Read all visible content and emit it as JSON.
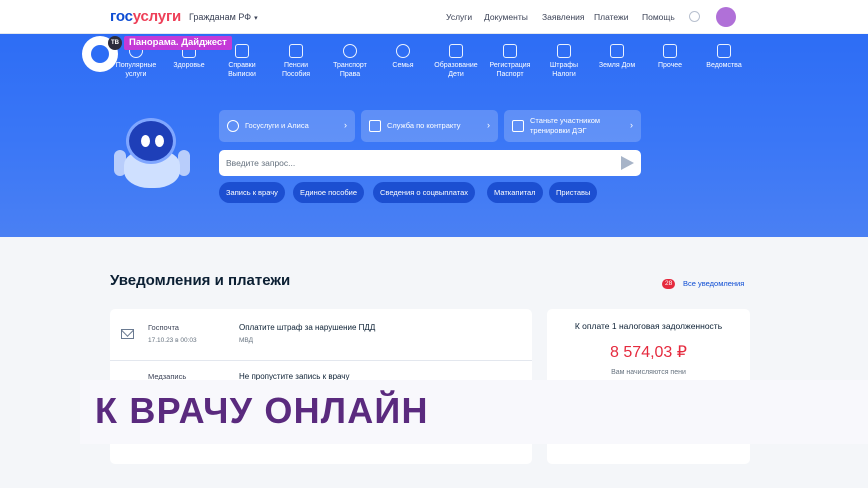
{
  "header": {
    "logo_part1": "гос",
    "logo_part2": "услуги",
    "audience_selector": "Гражданам РФ",
    "nav": [
      "Услуги",
      "Документы",
      "Заявления",
      "Платежи",
      "Помощь"
    ]
  },
  "tv_overlay": {
    "badge": "ТВ",
    "channel_label": "Панорама. Дайджест"
  },
  "categories": [
    [
      "Популярные",
      "услуги"
    ],
    [
      "Здоровье",
      ""
    ],
    [
      "Справки",
      "Выписки"
    ],
    [
      "Пенсии",
      "Пособия"
    ],
    [
      "Транспорт",
      "Права"
    ],
    [
      "Семья",
      ""
    ],
    [
      "Образование",
      "Дети"
    ],
    [
      "Регистрация",
      "Паспорт"
    ],
    [
      "Штрафы",
      "Налоги"
    ],
    [
      "Земля Дом",
      ""
    ],
    [
      "Прочее",
      ""
    ],
    [
      "Ведомства",
      ""
    ]
  ],
  "service_cards": [
    {
      "label": "Госуслуги и Алиса"
    },
    {
      "label": "Служба по контракту"
    },
    {
      "label": "Станьте участником тренировки ДЭГ"
    }
  ],
  "search": {
    "placeholder": "Введите запрос..."
  },
  "quick_chips": [
    "Запись к врачу",
    "Единое пособие",
    "Сведения о соцвыплатах",
    "Маткапитал",
    "Приставы"
  ],
  "notifications": {
    "title": "Уведомления и платежи",
    "count": "28",
    "all_link": "Все уведомления",
    "items": [
      {
        "source": "Госпочта",
        "date": "17.10.23 в 00:03",
        "title": "Оплатите штраф за нарушение ПДД",
        "org": "МВД"
      },
      {
        "source": "Медзапись",
        "title": "Не пропустите запись к врачу"
      }
    ]
  },
  "tax": {
    "title": "К оплате 1 налоговая задолженность",
    "amount": "8 574,03 ₽",
    "note": "Вам начисляются пени"
  },
  "headline": "К ВРАЧУ ОНЛАЙН",
  "colors": {
    "brand_blue": "#0d4cd3",
    "brand_red": "#ee3f58",
    "hero_blue": "#2d6df5",
    "chip_blue": "#1c4fd1",
    "amount_red": "#e52a3e",
    "headline_purple": "#5a2a7e",
    "channel_magenta": "#c43ad7"
  },
  "icons": [
    "search-icon",
    "avatar",
    "send-icon",
    "mail-icon",
    "chevron-right-icon",
    "robot-mascot"
  ]
}
